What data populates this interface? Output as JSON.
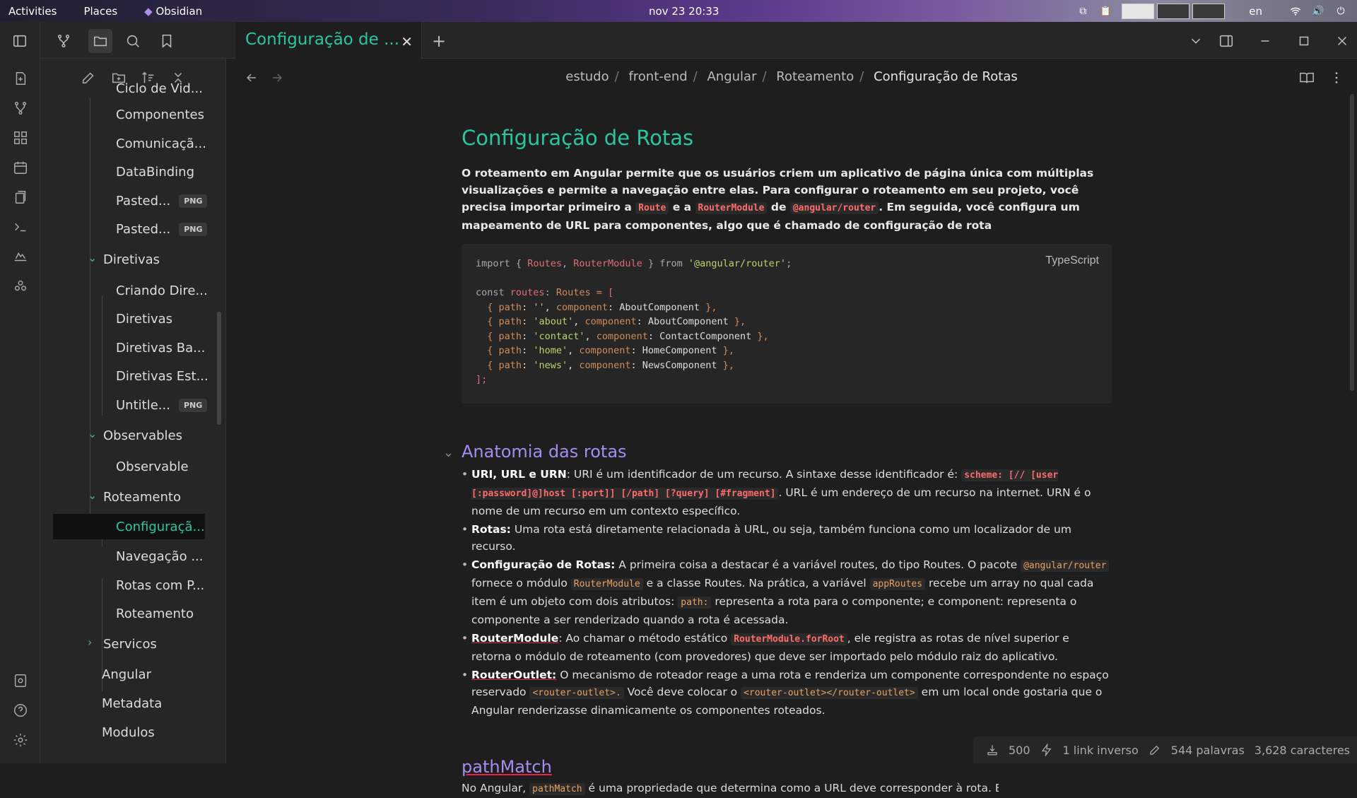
{
  "topbar": {
    "activities": "Activities",
    "places": "Places",
    "app": "Obsidian",
    "clock": "nov 23  20:33",
    "lang": "en"
  },
  "tab": {
    "label": "Configuração de ...",
    "close": "✕",
    "new": "+"
  },
  "breadcrumb": {
    "items": [
      "estudo",
      "front-end",
      "Angular",
      "Roteamento"
    ],
    "current": "Configuração de Rotas"
  },
  "tree": [
    {
      "label": "Ciclo de Vid...",
      "badge": ""
    },
    {
      "label": "Componentes",
      "badge": ""
    },
    {
      "label": "Comunicaçã...",
      "badge": ""
    },
    {
      "label": "DataBinding",
      "badge": ""
    },
    {
      "label": "Pasted...",
      "badge": "PNG"
    },
    {
      "label": "Pasted...",
      "badge": "PNG"
    },
    {
      "label": "Diretivas",
      "badge": ""
    },
    {
      "label": "Criando Dire...",
      "badge": ""
    },
    {
      "label": "Diretivas",
      "badge": ""
    },
    {
      "label": "Diretivas Ba...",
      "badge": ""
    },
    {
      "label": "Diretivas Est...",
      "badge": ""
    },
    {
      "label": "Untitle...",
      "badge": "PNG"
    },
    {
      "label": "Observables",
      "badge": ""
    },
    {
      "label": "Observable",
      "badge": ""
    },
    {
      "label": "Roteamento",
      "badge": ""
    },
    {
      "label": "Configuraçã...",
      "badge": ""
    },
    {
      "label": "Navegação ...",
      "badge": ""
    },
    {
      "label": "Rotas com P...",
      "badge": ""
    },
    {
      "label": "Roteamento",
      "badge": ""
    },
    {
      "label": "Servicos",
      "badge": ""
    },
    {
      "label": "Angular",
      "badge": ""
    },
    {
      "label": "Metadata",
      "badge": ""
    },
    {
      "label": "Modulos",
      "badge": ""
    }
  ],
  "doc": {
    "title": "Configuração de Rotas",
    "intro_1": "O roteamento em Angular permite que os usuários criem um aplicativo de página única com múltiplas visualizações e permite a navegação entre elas. Para configurar o roteamento em seu projeto, você precisa importar primeiro a",
    "intro_route": "Route",
    "intro_2": "e a",
    "intro_rm": "RouterModule",
    "intro_3": "de",
    "intro_pkg": "@angular/router",
    "intro_4": ". Em seguida, você configura um mapeamento de URL para componentes, algo que é chamado de configuração de rota",
    "code_lang": "TypeScript",
    "h2": "Anatomia das rotas",
    "b1_t": "URI, URL e URN",
    "b1_a": ": URI é um identificador de um recurso. A sintaxe desse identificador é:",
    "b1_c": "scheme: [// [user [:password]@]host [:port]] [/path] [?query] [#fragment]",
    "b1_b": ". URL é um endereço de um recurso na internet. URN é o nome de um recurso em um contexto específico.",
    "b2_t": "Rotas:",
    "b2_a": "Uma rota está diretamente relacionada à URL, ou seja, também funciona como um localizador de um recurso.",
    "b3_t": "Configuração de Rotas:",
    "b3_a": "A primeira coisa a destacar é a variável routes, do tipo Routes. O pacote",
    "b3_c1": "@angular/router",
    "b3_b": "fornece o módulo",
    "b3_c2": "RouterModule",
    "b3_d": "e a classe Routes. Na prática, a variável",
    "b3_c3": "appRoutes",
    "b3_e": "recebe um array no qual cada item é um objeto com dois atributos:",
    "b3_c4": "path:",
    "b3_f": "representa a rota para o componente; e component: representa o componente a ser renderizado quando a rota é acessada.",
    "b4_t": "RouterModule",
    "b4_a": ": Ao chamar o método estático",
    "b4_c": "RouterModule.forRoot",
    "b4_b": ", ele registra as rotas de nível superior e retorna o módulo de roteamento (com provedores) que deve ser importado pelo módulo raiz do aplicativo.",
    "b5_t": "RouterOutlet:",
    "b5_a": "O mecanismo de roteador reage a uma rota e renderiza um componente correspondente no espaço reservado",
    "b5_c1": "<router-outlet>.",
    "b5_b": "Você deve colocar o",
    "b5_c2": "<router-outlet></router-outlet>",
    "b5_d": "em um local onde gostaria que o Angular renderizasse dinamicamente os componentes roteados.",
    "h3": "pathMatch",
    "tail_a": "No Angular,",
    "tail_c": "pathMatch",
    "tail_b": "é uma propriedade que determina como a URL deve corresponder à rota. Exist"
  },
  "status": {
    "count": "500",
    "backlinks": "1 link inverso",
    "words": "544 palavras",
    "chars": "3,628 caracteres"
  },
  "colors": {
    "accent": "#27c7a0",
    "heading2": "#a48cf0",
    "inline_code": "#ff6b6b"
  }
}
